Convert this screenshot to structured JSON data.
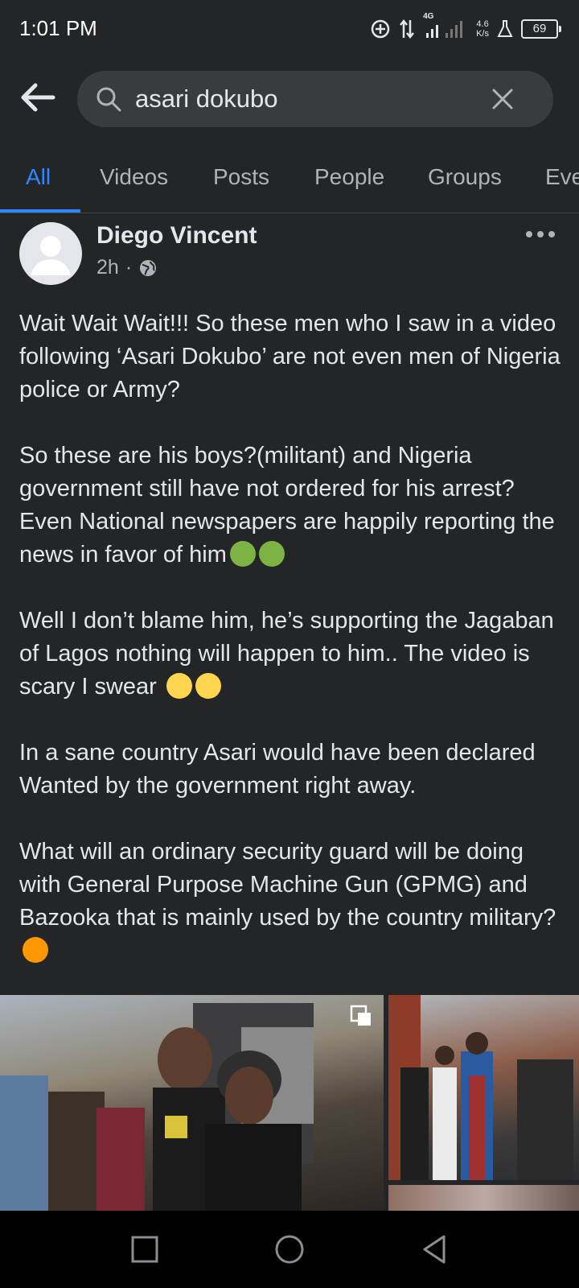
{
  "status_bar": {
    "time": "1:01 PM",
    "network_type": "4G",
    "net_speed_value": "4.6",
    "net_speed_unit": "K/s",
    "battery": "69"
  },
  "search": {
    "query": "asari dokubo"
  },
  "tabs": [
    {
      "label": "All",
      "active": true
    },
    {
      "label": "Videos"
    },
    {
      "label": "Posts"
    },
    {
      "label": "People"
    },
    {
      "label": "Groups"
    },
    {
      "label": "Eve"
    }
  ],
  "post": {
    "author": "Diego Vincent",
    "time": "2h",
    "separator": "·",
    "paragraphs": [
      "Wait Wait Wait!!! So these men who I saw in a video following ‘Asari Dokubo’ are not even men of Nigeria police or Army?",
      "So these are his boys?(militant) and Nigeria government still have not ordered for his arrest? Even National newspapers are happily reporting the news in favor of him",
      "Well I don’t blame him, he’s supporting the Jagaban of Lagos nothing will happen to him.. The video is scary I swear",
      "In a sane country Asari would have been declared Wanted by the government right away.",
      "What will an ordinary security guard will be doing with General Purpose Machine Gun (GPMG) and Bazooka that is mainly used by the country military?"
    ]
  },
  "colors": {
    "background": "#242526",
    "accent": "#2d88ff",
    "text": "#e4e6eb",
    "secondary_text": "#b0b3b8"
  }
}
